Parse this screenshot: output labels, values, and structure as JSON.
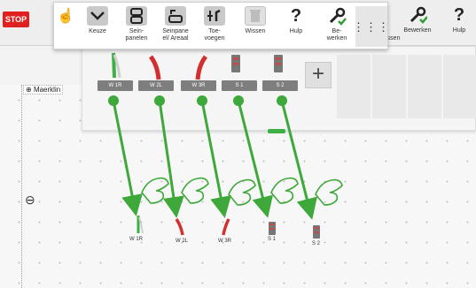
{
  "toolbar": {
    "stop_label": "STOP",
    "buttons": [
      {
        "label": "Keuze",
        "icon": "chevron-down-icon"
      },
      {
        "label": "Sein-\npanelen",
        "icon": "signal-panel-icon"
      },
      {
        "label": "Seinpane\nel/ Areaal",
        "icon": "signal-area-icon"
      },
      {
        "label": "Toe-\nvoegen",
        "icon": "add-item-icon"
      },
      {
        "label": "Wissen",
        "icon": "delete-icon"
      },
      {
        "label": "Hulp",
        "icon": "help-icon"
      },
      {
        "label": "Be-\nwerken",
        "icon": "edit-wrench-icon"
      }
    ],
    "background_labels": [
      "Wissen",
      "Bewerken",
      "Hulp"
    ]
  },
  "panel": {
    "items": [
      "W 1R",
      "W 2L",
      "W 3R",
      "S 1",
      "S 2"
    ]
  },
  "layout": {
    "name": "Maerklin",
    "placed_items": [
      "W 1R",
      "W 2L",
      "W 3R",
      "S 1",
      "S 2"
    ]
  },
  "colors": {
    "stop": "#e02020",
    "arrow": "#3ea83a",
    "turnout_green": "#3cb043",
    "turnout_red": "#d32f2f",
    "chip": "#7e7e7e"
  }
}
